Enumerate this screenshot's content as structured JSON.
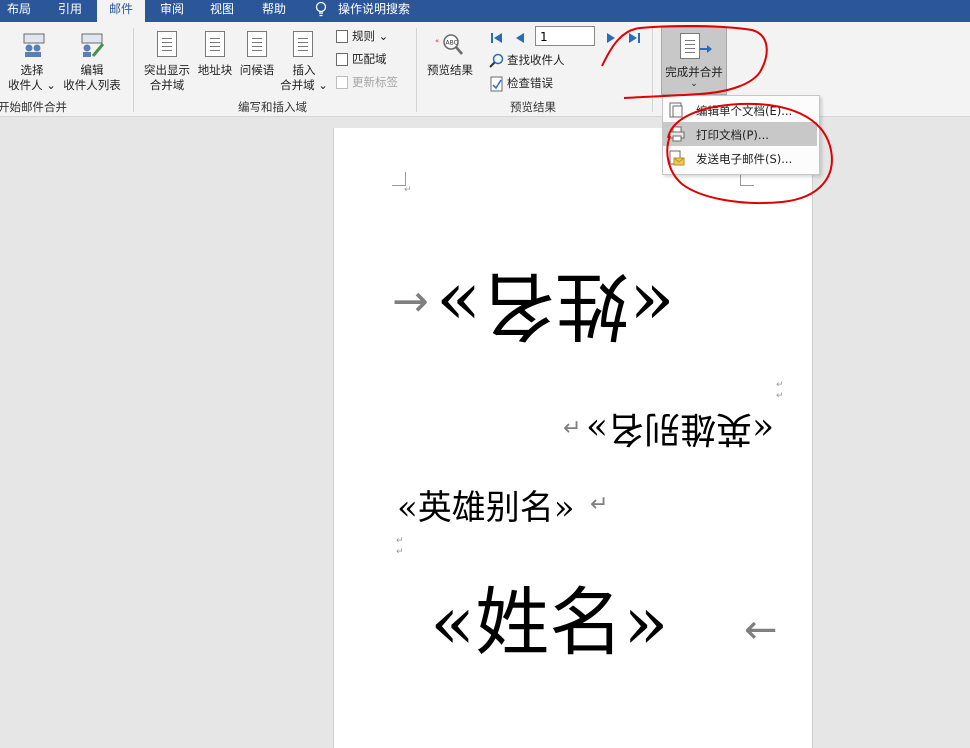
{
  "tabs": [
    {
      "label": "布局",
      "active": false
    },
    {
      "label": "引用",
      "active": false
    },
    {
      "label": "邮件",
      "active": true
    },
    {
      "label": "审阅",
      "active": false
    },
    {
      "label": "视图",
      "active": false
    },
    {
      "label": "帮助",
      "active": false
    }
  ],
  "tell_me": "操作说明搜索",
  "ribbon": {
    "start_group": {
      "select_recipients": [
        "选择",
        "收件人"
      ],
      "edit_recipients": [
        "编辑",
        "收件人列表"
      ],
      "label": "开始邮件合并"
    },
    "write_group": {
      "highlight_fields": [
        "突出显示",
        "合并域"
      ],
      "address_block": "地址块",
      "greeting_line": "问候语",
      "insert_field": [
        "插入",
        "合并域"
      ],
      "rules": "规则",
      "match_fields": "匹配域",
      "update_labels": "更新标签",
      "label": "编写和插入域"
    },
    "preview_group": {
      "preview_results": "预览结果",
      "record_number": "1",
      "find_recipient": "查找收件人",
      "check_errors": "检查错误",
      "label": "预览结果"
    },
    "finish_group": {
      "finish_merge": "完成并合并"
    }
  },
  "menu": {
    "items": [
      {
        "label": "编辑单个文档(E)..."
      },
      {
        "label": "打印文档(P)...",
        "highlighted": true
      },
      {
        "label": "发送电子邮件(S)..."
      }
    ]
  },
  "document": {
    "name_field_upside": "«姓名»",
    "alias_field_upside": "«英雄别名»",
    "alias_field": "«英雄别名»",
    "name_field": "«姓名»"
  },
  "colors": {
    "tab_bar": "#2b579a",
    "ribbon_bg": "#f3f3f3",
    "menu_highlight": "#c8c8c8",
    "annotation_red": "#e00000"
  }
}
